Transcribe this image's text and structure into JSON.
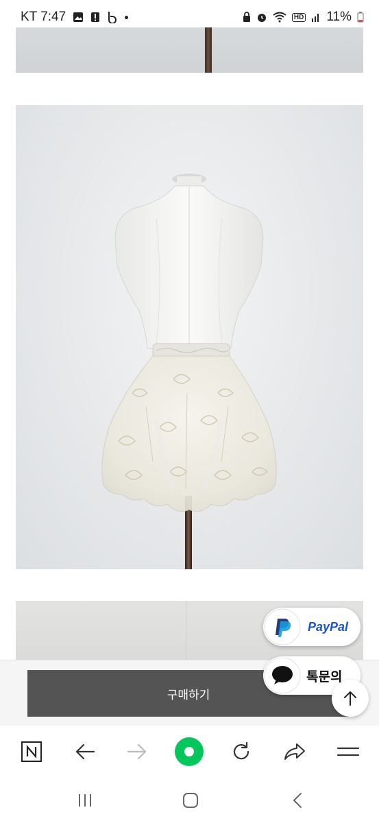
{
  "status_bar": {
    "carrier_time": "KT 7:47",
    "hd_label": "HD",
    "battery": "11%"
  },
  "product": {
    "buy_label": "구매하기"
  },
  "floating": {
    "paypal_label": "PayPal",
    "chat_label": "톡문의"
  },
  "colors": {
    "buy_button": "#545454",
    "paypal_blue": "#1b56c9",
    "naver_green": "#03c75a"
  },
  "icons": {
    "toolbar": [
      "naver-home-icon",
      "back-arrow-icon",
      "forward-arrow-icon",
      "green-dot-icon",
      "refresh-icon",
      "share-icon",
      "menu-icon"
    ],
    "nav": [
      "recent-apps-icon",
      "home-icon",
      "back-icon"
    ]
  }
}
